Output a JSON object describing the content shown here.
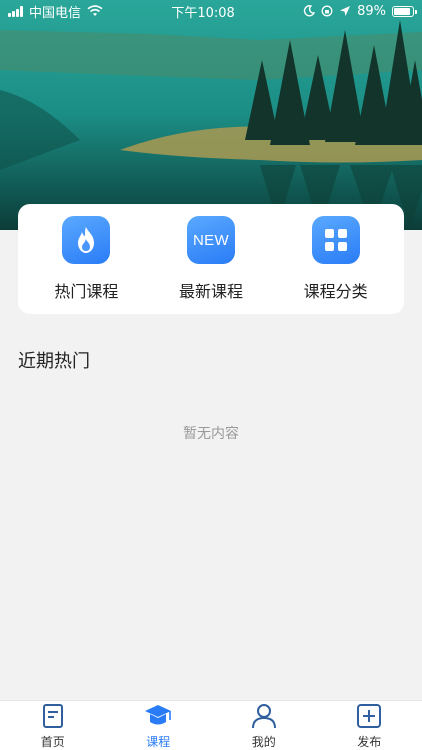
{
  "status_bar": {
    "carrier": "中国电信",
    "time": "下午10:08",
    "battery": "89%",
    "battery_level": 0.89
  },
  "hero": {
    "icon": "landscape-photo"
  },
  "quick_entries": [
    {
      "label": "热门课程",
      "icon": "flame-icon"
    },
    {
      "label": "最新课程",
      "icon": "new-badge-icon",
      "badge_text": "NEW"
    },
    {
      "label": "课程分类",
      "icon": "grid-icon"
    }
  ],
  "section": {
    "title": "近期热门",
    "empty_text": "暂无内容"
  },
  "tabbar": {
    "tabs": [
      {
        "label": "首页",
        "icon": "document-icon",
        "active": false
      },
      {
        "label": "课程",
        "icon": "graduation-cap-icon",
        "active": true
      },
      {
        "label": "我的",
        "icon": "user-icon",
        "active": false
      },
      {
        "label": "发布",
        "icon": "plus-square-icon",
        "active": false
      }
    ]
  },
  "colors": {
    "accent": "#2a7cf6",
    "tab_inactive": "#2f5f9e",
    "background": "#f2f2f2"
  }
}
